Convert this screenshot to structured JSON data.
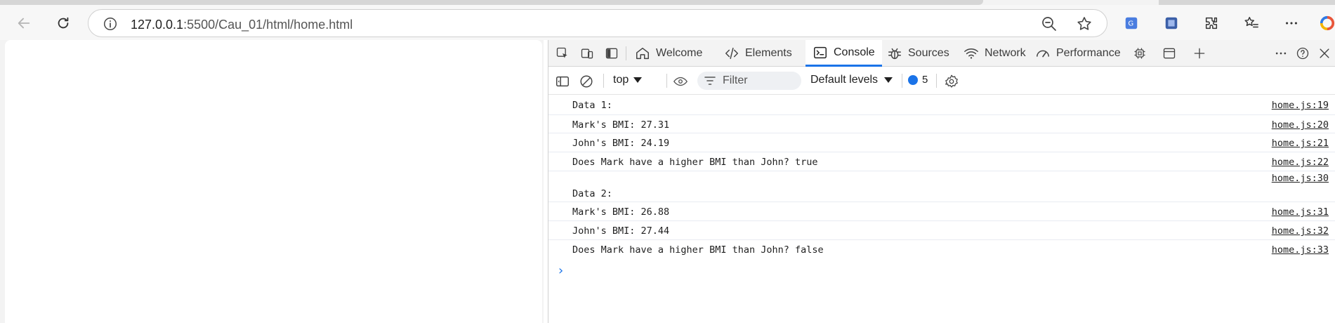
{
  "browser": {
    "url_host": "127.0.0.1",
    "url_rest": ":5500/Cau_01/html/home.html"
  },
  "devtools": {
    "tabs": [
      {
        "label": "Welcome",
        "icon": "home-icon"
      },
      {
        "label": "Elements",
        "icon": "code-icon"
      },
      {
        "label": "Console",
        "icon": "console-icon",
        "active": true
      },
      {
        "label": "Sources",
        "icon": "bug-icon"
      },
      {
        "label": "Network",
        "icon": "wifi-icon"
      },
      {
        "label": "Performance",
        "icon": "gauge-icon"
      }
    ],
    "accent_color": "#1a73e8"
  },
  "console": {
    "context": "top",
    "filter_placeholder": "Filter",
    "levels": "Default levels",
    "issues_count": "5",
    "logs": [
      {
        "message": "Data 1:",
        "source": "home.js:19"
      },
      {
        "message": "Mark's BMI: 27.31",
        "source": "home.js:20"
      },
      {
        "message": "John's BMI: 24.19",
        "source": "home.js:21"
      },
      {
        "message": "Does Mark have a higher BMI than John? true",
        "source": "home.js:22"
      },
      {
        "message": "",
        "source": "home.js:30"
      },
      {
        "message": "Data 2:",
        "source": ""
      },
      {
        "message": "Mark's BMI: 26.88",
        "source": "home.js:31"
      },
      {
        "message": "John's BMI: 27.44",
        "source": "home.js:32"
      },
      {
        "message": "Does Mark have a higher BMI than John? false",
        "source": "home.js:33"
      }
    ]
  }
}
